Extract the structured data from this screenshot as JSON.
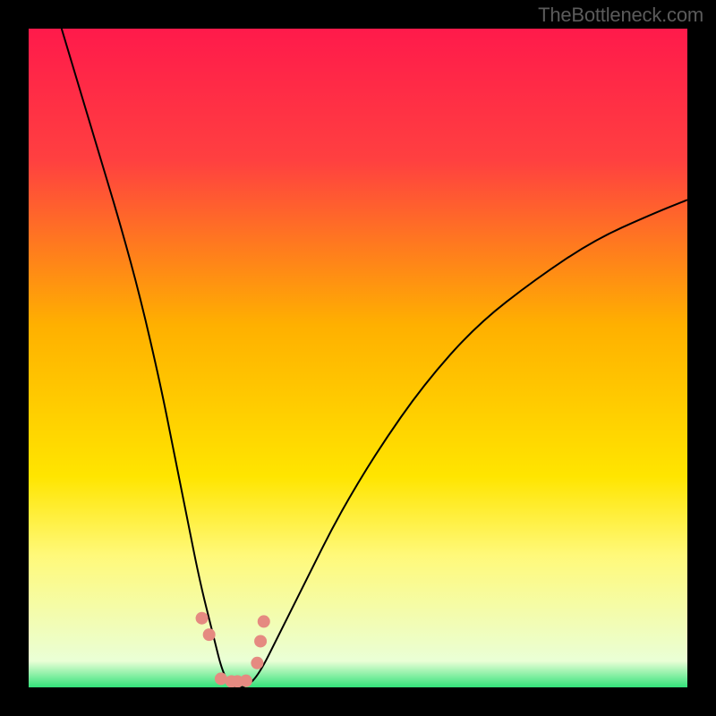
{
  "watermark": "TheBottleneck.com",
  "chart_data": {
    "type": "line",
    "title": "",
    "xlabel": "",
    "ylabel": "",
    "xlim": [
      0,
      100
    ],
    "ylim": [
      0,
      100
    ],
    "legend": false,
    "grid": false,
    "background_gradient_stops": [
      {
        "offset": 0.0,
        "color": "#ff1a4b"
      },
      {
        "offset": 0.2,
        "color": "#ff4040"
      },
      {
        "offset": 0.45,
        "color": "#ffb000"
      },
      {
        "offset": 0.68,
        "color": "#ffe500"
      },
      {
        "offset": 0.8,
        "color": "#fff97a"
      },
      {
        "offset": 0.96,
        "color": "#eaffd6"
      },
      {
        "offset": 1.0,
        "color": "#33e27a"
      }
    ],
    "series": [
      {
        "name": "bottleneck-curve",
        "stroke": "#000000",
        "stroke_width": 2,
        "x": [
          5,
          8,
          11,
          14,
          17,
          20,
          22,
          24,
          26,
          28,
          29.5,
          31,
          33,
          35,
          38,
          42,
          47,
          53,
          60,
          68,
          77,
          86,
          95,
          100
        ],
        "y": [
          100,
          90,
          80,
          70,
          59,
          46,
          36,
          26,
          16,
          8,
          2,
          0,
          0,
          2,
          8,
          16,
          26,
          36,
          46,
          55,
          62,
          68,
          72,
          74
        ]
      },
      {
        "name": "marker-cluster",
        "type": "scatter",
        "marker_color": "#e58a81",
        "marker_radius": 7,
        "x": [
          26.3,
          27.4,
          29.2,
          30.8,
          31.7,
          33.0,
          34.7,
          35.2,
          35.7
        ],
        "y": [
          10.5,
          8.0,
          1.3,
          0.9,
          0.9,
          1.0,
          3.7,
          7.0,
          10.0
        ]
      }
    ]
  }
}
